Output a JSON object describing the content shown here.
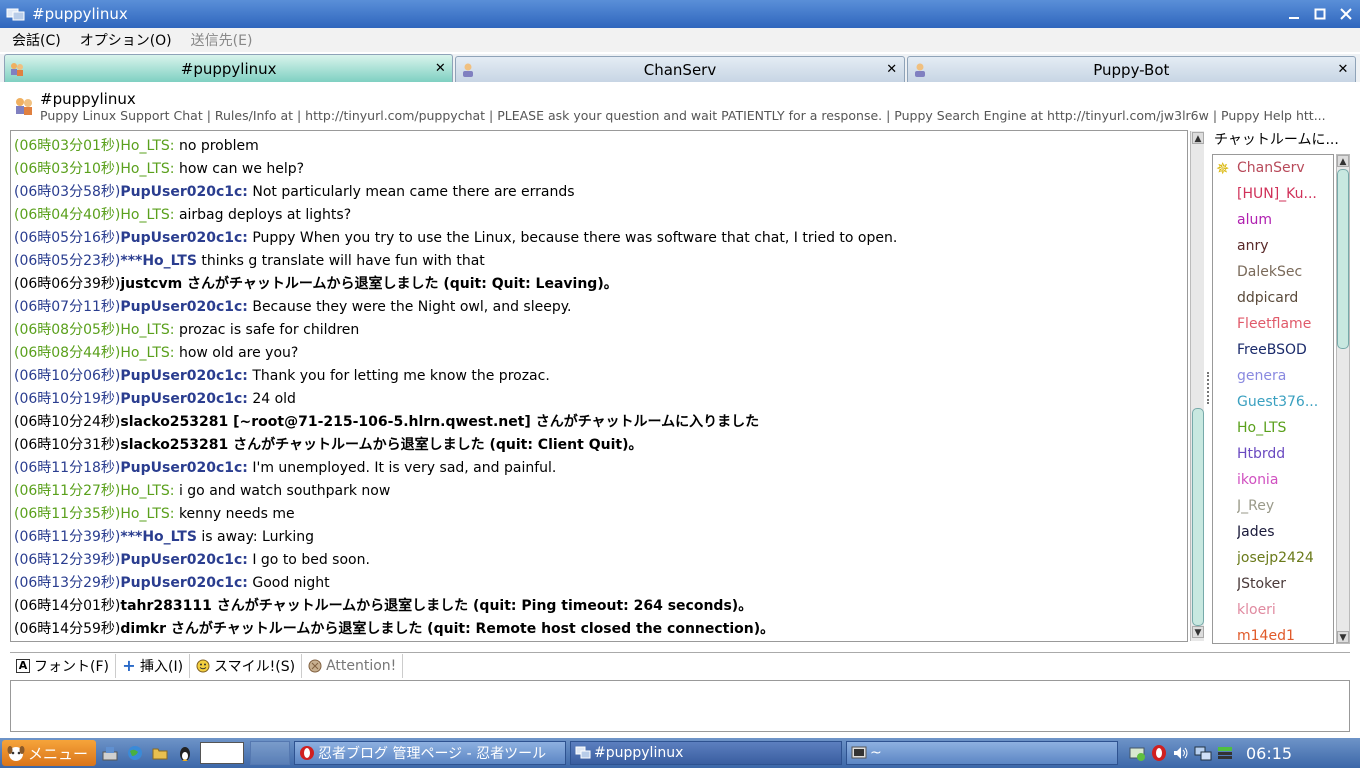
{
  "window": {
    "title": "#puppylinux"
  },
  "menu": [
    {
      "label": "会話(C)",
      "disabled": false
    },
    {
      "label": "オプション(O)",
      "disabled": false
    },
    {
      "label": "送信先(E)",
      "disabled": true
    }
  ],
  "tabs": [
    {
      "label": "#puppylinux",
      "active": true
    },
    {
      "label": "ChanServ",
      "active": false
    },
    {
      "label": "Puppy-Bot",
      "active": false
    }
  ],
  "topic": {
    "channel": "#puppylinux",
    "text": "Puppy Linux Support Chat | Rules/Info at | http://tinyurl.com/puppychat | PLEASE ask your question and wait PATIENTLY for a response. | Puppy Search Engine at http://tinyurl.com/jw3lr6w | Puppy Help htt..."
  },
  "messages": [
    {
      "ts": "(06時03分01秒)",
      "nick": "Ho_LTS:",
      "text": " no problem",
      "style": "green"
    },
    {
      "ts": "(06時03分10秒)",
      "nick": "Ho_LTS:",
      "text": " how can we help?",
      "style": "green"
    },
    {
      "ts": "(06時03分58秒)",
      "nick": "PupUser020c1c:",
      "text": " Not particularly mean came there are errands",
      "style": "blue"
    },
    {
      "ts": "(06時04分40秒)",
      "nick": "Ho_LTS:",
      "text": " airbag deploys at lights?",
      "style": "green"
    },
    {
      "ts": "(06時05分16秒)",
      "nick": "PupUser020c1c:",
      "text": " Puppy When you try to use the Linux, because there was software that chat, I tried to open.",
      "style": "blue"
    },
    {
      "ts": "(06時05分23秒)",
      "nick": "***Ho_LTS",
      "text": " thinks g translate will have fun with that",
      "style": "action"
    },
    {
      "ts": "(06時06分39秒)",
      "nick": "justcvm",
      "text": " さんがチャットルームから退室しました (quit: Quit: Leaving)。",
      "style": "system"
    },
    {
      "ts": "(06時07分11秒)",
      "nick": "PupUser020c1c:",
      "text": " Because they were the Night owl, and sleepy.",
      "style": "blue"
    },
    {
      "ts": "(06時08分05秒)",
      "nick": "Ho_LTS:",
      "text": " prozac is safe for children",
      "style": "green"
    },
    {
      "ts": "(06時08分44秒)",
      "nick": "Ho_LTS:",
      "text": " how old are you?",
      "style": "green"
    },
    {
      "ts": "(06時10分06秒)",
      "nick": "PupUser020c1c:",
      "text": " Thank you for letting me know the prozac.",
      "style": "blue"
    },
    {
      "ts": "(06時10分19秒)",
      "nick": "PupUser020c1c:",
      "text": " 24 old",
      "style": "blue"
    },
    {
      "ts": "(06時10分24秒)",
      "nick": "slacko253281",
      "text": " [~root@71-215-106-5.hlrn.qwest.net] さんがチャットルームに入りました",
      "style": "join"
    },
    {
      "ts": "(06時10分31秒)",
      "nick": "slacko253281",
      "text": " さんがチャットルームから退室しました (quit: Client Quit)。",
      "style": "system"
    },
    {
      "ts": "(06時11分18秒)",
      "nick": "PupUser020c1c:",
      "text": " I'm unemployed. It is very sad, and painful.",
      "style": "blue"
    },
    {
      "ts": "(06時11分27秒)",
      "nick": "Ho_LTS:",
      "text": " i go and watch southpark now",
      "style": "green"
    },
    {
      "ts": "(06時11分35秒)",
      "nick": "Ho_LTS:",
      "text": " kenny needs me",
      "style": "green"
    },
    {
      "ts": "(06時11分39秒)",
      "nick": "***Ho_LTS",
      "text": " is away: Lurking",
      "style": "action"
    },
    {
      "ts": "(06時12分39秒)",
      "nick": "PupUser020c1c:",
      "text": " I go to bed soon.",
      "style": "blue"
    },
    {
      "ts": "(06時13分29秒)",
      "nick": "PupUser020c1c:",
      "text": " Good night",
      "style": "blue"
    },
    {
      "ts": "(06時14分01秒)",
      "nick": "tahr283111",
      "text": " さんがチャットルームから退室しました (quit: Ping timeout: 264 seconds)。",
      "style": "system"
    },
    {
      "ts": "(06時14分59秒)",
      "nick": "dimkr",
      "text": " さんがチャットルームから退室しました (quit: Remote host closed the connection)。",
      "style": "system"
    }
  ],
  "userpane": {
    "header": "チャットルームに...",
    "users": [
      {
        "name": "ChanServ",
        "color": "#b84a5a",
        "op": true
      },
      {
        "name": "[HUN]_Ku...",
        "color": "#d0325a",
        "op": false
      },
      {
        "name": "alum",
        "color": "#b020b0",
        "op": false
      },
      {
        "name": "anry",
        "color": "#5a2a2a",
        "op": false
      },
      {
        "name": "DalekSec",
        "color": "#7a6a5a",
        "op": false
      },
      {
        "name": "ddpicard",
        "color": "#5a4a3a",
        "op": false
      },
      {
        "name": "Fleetflame",
        "color": "#e05a6a",
        "op": false
      },
      {
        "name": "FreeBSOD",
        "color": "#1a2a6a",
        "op": false
      },
      {
        "name": "genera",
        "color": "#8a8ae0",
        "op": false
      },
      {
        "name": "Guest376...",
        "color": "#3aa0c0",
        "op": false
      },
      {
        "name": "Ho_LTS",
        "color": "#5aa01c",
        "op": false
      },
      {
        "name": "Htbrdd",
        "color": "#6a4ac0",
        "op": false
      },
      {
        "name": "ikonia",
        "color": "#d050c0",
        "op": false
      },
      {
        "name": "J_Rey",
        "color": "#9a9a8a",
        "op": false
      },
      {
        "name": "Jades",
        "color": "#1a1a3a",
        "op": false
      },
      {
        "name": "josejp2424",
        "color": "#6a7a1a",
        "op": false
      },
      {
        "name": "JStoker",
        "color": "#4a3a3a",
        "op": false
      },
      {
        "name": "kloeri",
        "color": "#e08aa0",
        "op": false
      },
      {
        "name": "m14ed1",
        "color": "#e05a2a",
        "op": false
      }
    ]
  },
  "formatbar": {
    "font": "フォント(F)",
    "insert": "挿入(I)",
    "smiley": "スマイル!(S)",
    "attention": "Attention!"
  },
  "taskbar": {
    "start": "メニュー",
    "tasks": [
      {
        "label": "忍者ブログ 管理ページ - 忍者ツール",
        "active": false
      },
      {
        "label": "#puppylinux",
        "active": true
      },
      {
        "label": "~",
        "active": false
      }
    ],
    "clock": "06:15"
  }
}
